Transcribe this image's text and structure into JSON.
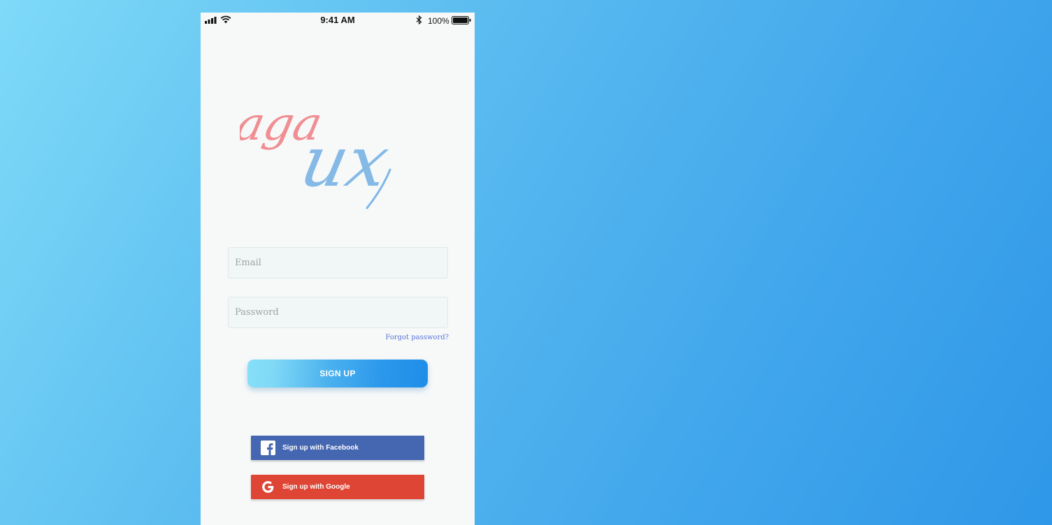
{
  "status_bar": {
    "time": "9:41 AM",
    "battery_percent": "100%",
    "icons": [
      "signal-icon",
      "wifi-icon",
      "bluetooth-icon",
      "battery-icon"
    ]
  },
  "logo": {
    "line1": "aga",
    "line2": "ux",
    "colors": {
      "line1": "#f08a8e",
      "line2": "#7fb6e6"
    }
  },
  "form": {
    "email_placeholder": "Email",
    "password_placeholder": "Password",
    "forgot_password": "Forgot password?",
    "signup_label": "SIGN UP"
  },
  "social": {
    "facebook_label": "Sign up with Facebook",
    "google_label": "Sign up with Google",
    "colors": {
      "facebook": "#4566b1",
      "google": "#de4535"
    }
  }
}
